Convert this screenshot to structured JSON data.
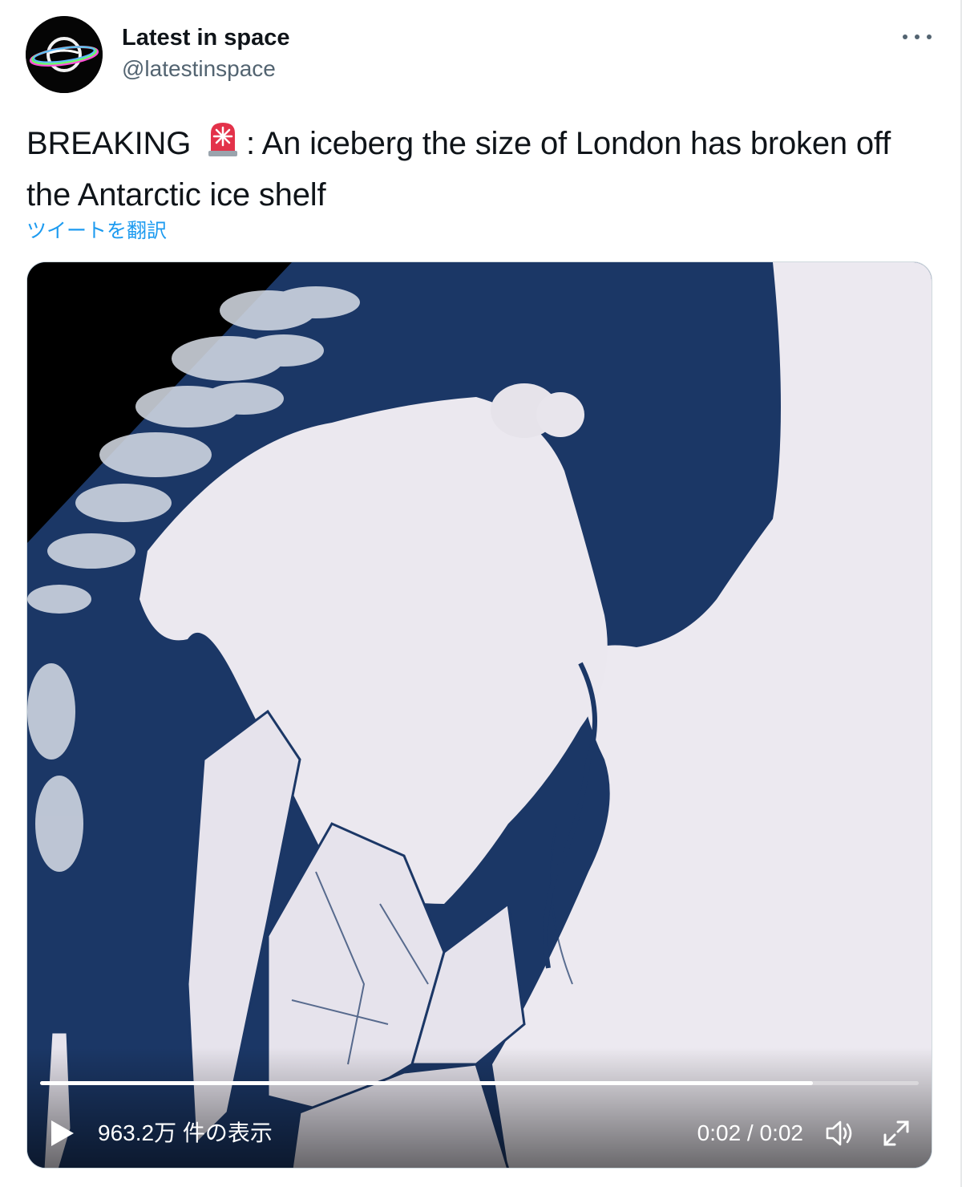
{
  "tweet": {
    "author": {
      "display_name": "Latest in space",
      "handle": "@latestinspace",
      "avatar_icon": "saturn-logo-icon"
    },
    "more_icon": "more-options-icon",
    "text_before_emoji": "BREAKING ",
    "emoji_icon": "rotating-light-siren-icon",
    "text_after_emoji": ": An iceberg the size of London has broken off the Antarctic ice shelf",
    "translate_label": "ツイートを翻訳"
  },
  "video": {
    "views_label": "963.2万 件の表示",
    "time_label": "0:02 / 0:02",
    "progress": 0.88,
    "play_icon": "play-icon",
    "volume_icon": "volume-icon",
    "fullscreen_icon": "fullscreen-icon",
    "colors": {
      "ocean": "#1b3766",
      "ice": "#e9e6ee",
      "space": "#000000"
    }
  },
  "colors": {
    "text": "#0f1419",
    "secondary": "#536471",
    "link": "#1d9bf0"
  }
}
